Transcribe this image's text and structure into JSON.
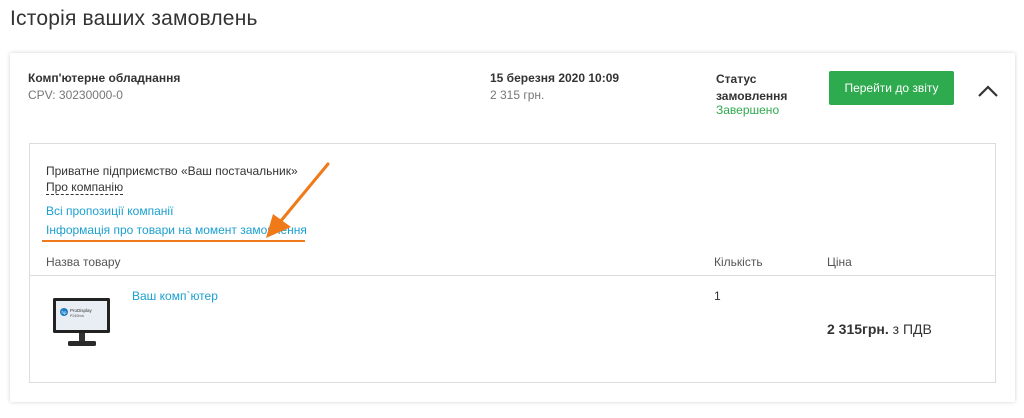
{
  "page": {
    "title": "Історія ваших замовлень"
  },
  "order": {
    "product_title": "Комп'ютерне обладнання",
    "cpv": "CPV: 30230000-0",
    "date": "15 березня 2020 10:09",
    "sum": "2 315 грн.",
    "status_label": "Статус замовлення",
    "status_value": "Завершено",
    "report_button": "Перейти до звіту",
    "toggle_icon": "chevron-up-icon"
  },
  "details": {
    "supplier_name": "Приватне підприємство «Ваш постачальник»",
    "about_link": "Про компанію",
    "all_offers_link": "Всі пропозиції компанії",
    "info_link": "Інформація про товари на момент замовлення",
    "annotation_color": "#f07a18"
  },
  "items_table": {
    "headers": {
      "name": "Назва товару",
      "qty": "Кількість",
      "price": "Ціна"
    },
    "rows": [
      {
        "name": "Ваш комп`ютер",
        "qty": "1",
        "price_value": "2 315грн.",
        "price_suffix": " з ПДВ",
        "image_icon": "monitor-icon",
        "image_text": {
          "brand": "hp",
          "line1": "ProDisplay",
          "line2": "P240hvb"
        }
      }
    ]
  },
  "colors": {
    "accent_green": "#2eaa4f",
    "link_blue": "#1a9fd0"
  }
}
